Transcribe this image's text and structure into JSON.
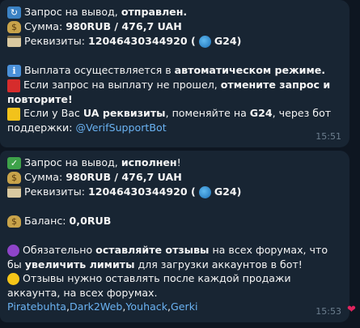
{
  "messages": [
    {
      "status_prefix": "Запрос на вывод, ",
      "status_value": "отправлен.",
      "amount_label": "Сумма: ",
      "amount_value": "980RUB  / 476,7 UAH",
      "requisites_label": "Реквизиты: ",
      "requisites_value": "12046430344920 (",
      "requisites_tail": "G24)",
      "info_prefix": "Выплата осуществляется в ",
      "info_value": "автоматическом режиме.",
      "fail_prefix": "Если запрос на выплату не прошел, ",
      "fail_value": "отмените запрос и повторите!",
      "ua_prefix": "Если у Вас ",
      "ua_value": "UA реквизиты",
      "ua_mid": ", поменяйте на ",
      "ua_g24": "G24",
      "ua_tail": ", через бот поддержки: ",
      "support_link": "@VerifSupportBot",
      "time": "15:51"
    },
    {
      "status_prefix": "Запрос на вывод, ",
      "status_value": "исполнен",
      "status_suffix": "!",
      "amount_label": "Сумма: ",
      "amount_value": "980RUB  / 476,7 UAH",
      "requisites_label": "Реквизиты: ",
      "requisites_value": "12046430344920 (",
      "requisites_tail": "G24)",
      "balance_label": "Баланс: ",
      "balance_value": "0,0RUB",
      "reviews_prefix": "Обязательно ",
      "reviews_value": "оставляйте отзывы",
      "reviews_mid": " на всех форумах, что бы ",
      "reviews_value2": "увеличить лимиты",
      "reviews_tail": " для загрузки аккаунтов в бот!",
      "after_sale": "Отзывы нужно оставлять после каждой продажи аккаунта, на всех форумах.",
      "forums": [
        "Piratebuhta",
        "Dark2Web",
        "Youhack",
        "Gerki"
      ],
      "forum_sep": ", ",
      "time": "15:53",
      "reaction": "❤"
    }
  ],
  "icons": {
    "refresh": "refresh-icon",
    "money_bag": "money-bag-icon",
    "credit_card": "credit-card-icon",
    "globe": "globe-icon",
    "info": "info-icon",
    "red_square": "red-square-icon",
    "yellow_square": "yellow-square-icon",
    "check": "check-mark-icon",
    "purple_circle": "purple-circle-icon",
    "yellow_circle": "yellow-circle-icon",
    "heart": "heart-icon"
  },
  "colors": {
    "background": "#0e1621",
    "bubble": "#182533",
    "link": "#6ab2f2",
    "timestamp": "#6d7f8f",
    "reaction": "#e0245e"
  }
}
